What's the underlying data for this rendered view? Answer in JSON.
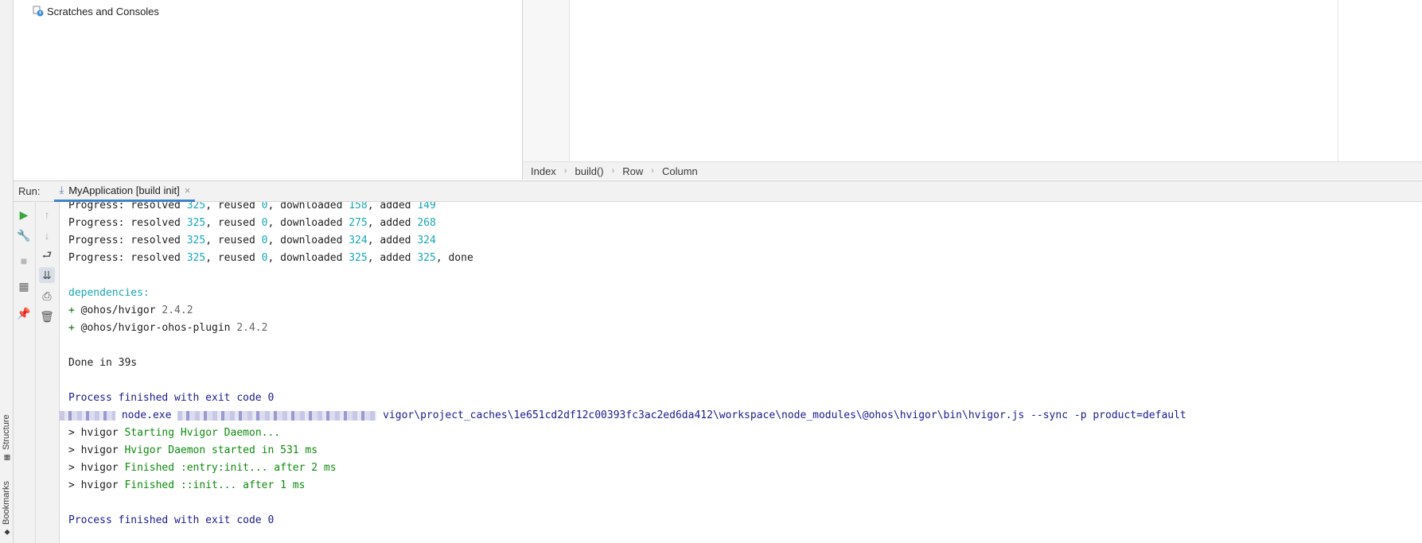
{
  "sidebar": {
    "tabs": [
      {
        "label": "Structure"
      },
      {
        "label": "Bookmarks"
      }
    ]
  },
  "project_tree": {
    "items": [
      {
        "label": "Scratches and Consoles",
        "icon": "scratches-icon"
      }
    ]
  },
  "breadcrumb": {
    "items": [
      "Index",
      "build()",
      "Row",
      "Column"
    ],
    "separator": "›"
  },
  "run_panel": {
    "label": "Run:",
    "tab": {
      "label": "MyApplication [build init]",
      "close": "×"
    }
  },
  "console": {
    "progress": [
      {
        "prefix": "Progress: resolved ",
        "resolved": "325",
        "r2": ", reused ",
        "reused": "0",
        "d": ", downloaded ",
        "downloaded": "158",
        "a": ", added ",
        "added": "149",
        "tail": ""
      },
      {
        "prefix": "Progress: resolved ",
        "resolved": "325",
        "r2": ", reused ",
        "reused": "0",
        "d": ", downloaded ",
        "downloaded": "275",
        "a": ", added ",
        "added": "268",
        "tail": ""
      },
      {
        "prefix": "Progress: resolved ",
        "resolved": "325",
        "r2": ", reused ",
        "reused": "0",
        "d": ", downloaded ",
        "downloaded": "324",
        "a": ", added ",
        "added": "324",
        "tail": ""
      },
      {
        "prefix": "Progress: resolved ",
        "resolved": "325",
        "r2": ", reused ",
        "reused": "0",
        "d": ", downloaded ",
        "downloaded": "325",
        "a": ", added ",
        "added": "325",
        "tail": ", done"
      }
    ],
    "dependencies_header": "dependencies:",
    "dependencies": [
      {
        "plus": "+ ",
        "name": "@ohos/hvigor",
        "version": "2.4.2"
      },
      {
        "plus": "+ ",
        "name": "@ohos/hvigor-ohos-plugin",
        "version": "2.4.2"
      }
    ],
    "done": "Done in 39s",
    "exit_1": "Process finished with exit code 0",
    "command_visible": "node.exe",
    "command_path": "vigor\\project_caches\\1e651cd2df12c00393fc3ac2ed6da412\\workspace\\node_modules\\@ohos\\hvigor\\bin\\hvigor.js --sync -p product=default",
    "hvigor_lines": [
      {
        "prefix": "> hvigor ",
        "msg": "Starting Hvigor Daemon..."
      },
      {
        "prefix": "> hvigor ",
        "msg": "Hvigor Daemon started in 531 ms"
      },
      {
        "prefix": "> hvigor ",
        "msg": "Finished :entry:init... after 2 ms"
      },
      {
        "prefix": "> hvigor ",
        "msg": "Finished ::init... after 1 ms"
      }
    ],
    "exit_2": "Process finished with exit code 0"
  }
}
